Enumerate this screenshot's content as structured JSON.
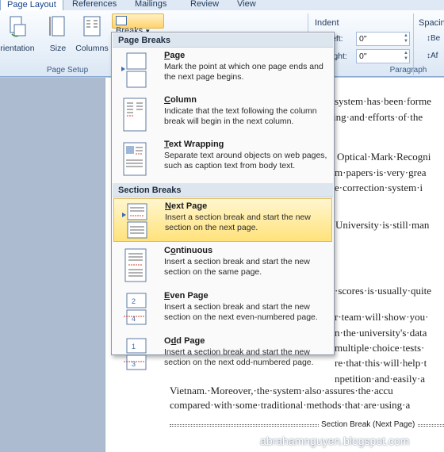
{
  "tabs": [
    {
      "label": "Page Layout",
      "active": true
    },
    {
      "label": "References",
      "active": false
    },
    {
      "label": "Mailings",
      "active": false
    },
    {
      "label": "Review",
      "active": false
    },
    {
      "label": "View",
      "active": false
    }
  ],
  "ribbon": {
    "orientation_label": "rientation",
    "size_label": "Size",
    "columns_label": "Columns",
    "page_setup_group": "Page Setup",
    "breaks_label": "Breaks",
    "indent_label": "Indent",
    "indent_left_label": "eft:",
    "indent_left_value": "0\"",
    "indent_right_label": "ight:",
    "indent_right_value": "0\"",
    "spacing_label": "Spacin",
    "spacing_before": "Be",
    "spacing_after": "Af",
    "paragraph_group": "Paragraph"
  },
  "menu": {
    "page_breaks_header": "Page Breaks",
    "section_breaks_header": "Section Breaks",
    "items": [
      {
        "title": "Page",
        "underline": "P",
        "rest": "age",
        "desc": "Mark the point at which one page ends and the next page begins.",
        "icon": "page-break-icon"
      },
      {
        "title": "Column",
        "underline": "C",
        "rest": "olumn",
        "desc": "Indicate that the text following the column break will begin in the next column.",
        "icon": "column-break-icon"
      },
      {
        "title": "Text Wrapping",
        "underline": "T",
        "rest": "ext Wrapping",
        "desc": "Separate text around objects on web pages, such as caption text from body text.",
        "icon": "text-wrapping-break-icon"
      },
      {
        "title": "Next Page",
        "underline": "N",
        "rest": "ext Page",
        "desc": "Insert a section break and start the new section on the next page.",
        "icon": "next-page-break-icon",
        "highlighted": true
      },
      {
        "title": "Continuous",
        "underline": "o",
        "rest": "ntinuous",
        "prefix": "C",
        "desc": "Insert a section break and start the new section on the same page.",
        "icon": "continuous-break-icon"
      },
      {
        "title": "Even Page",
        "underline": "E",
        "rest": "ven Page",
        "desc": "Insert a section break and start the new section on the next even-numbered page.",
        "icon": "even-page-break-icon"
      },
      {
        "title": "Odd Page",
        "underline": "d",
        "rest": "d Page",
        "prefix": "O",
        "desc": "Insert a section break and start the new section on the next odd-numbered page.",
        "icon": "odd-page-break-icon"
      }
    ]
  },
  "document": {
    "lines": [
      "system·has·been·forme",
      "ing·and·efforts·of·the",
      "Optical·Mark·Recogni",
      "m·papers·is·very·grea",
      "e·correction·system·i",
      "University·is·still·man",
      "·scores·is·usually·quite",
      "r·team·will·show·you·",
      "n·the·university's·data",
      "multiple·choice·tests·",
      "re·that·this·will·help·t",
      "npetition·and·easily·a",
      "Vietnam.·Moreover,·the·system·also·assures·the·accu",
      "compared·with·some·traditional·methods·that·are·using·a"
    ],
    "section_break": "Section Break (Next Page)"
  },
  "watermark": "abrahamnguyen.blogspot.com",
  "colors": {
    "accent": "#ffd26d",
    "highlight": "#ffe27b",
    "ribbon": "#dbe7f5"
  }
}
